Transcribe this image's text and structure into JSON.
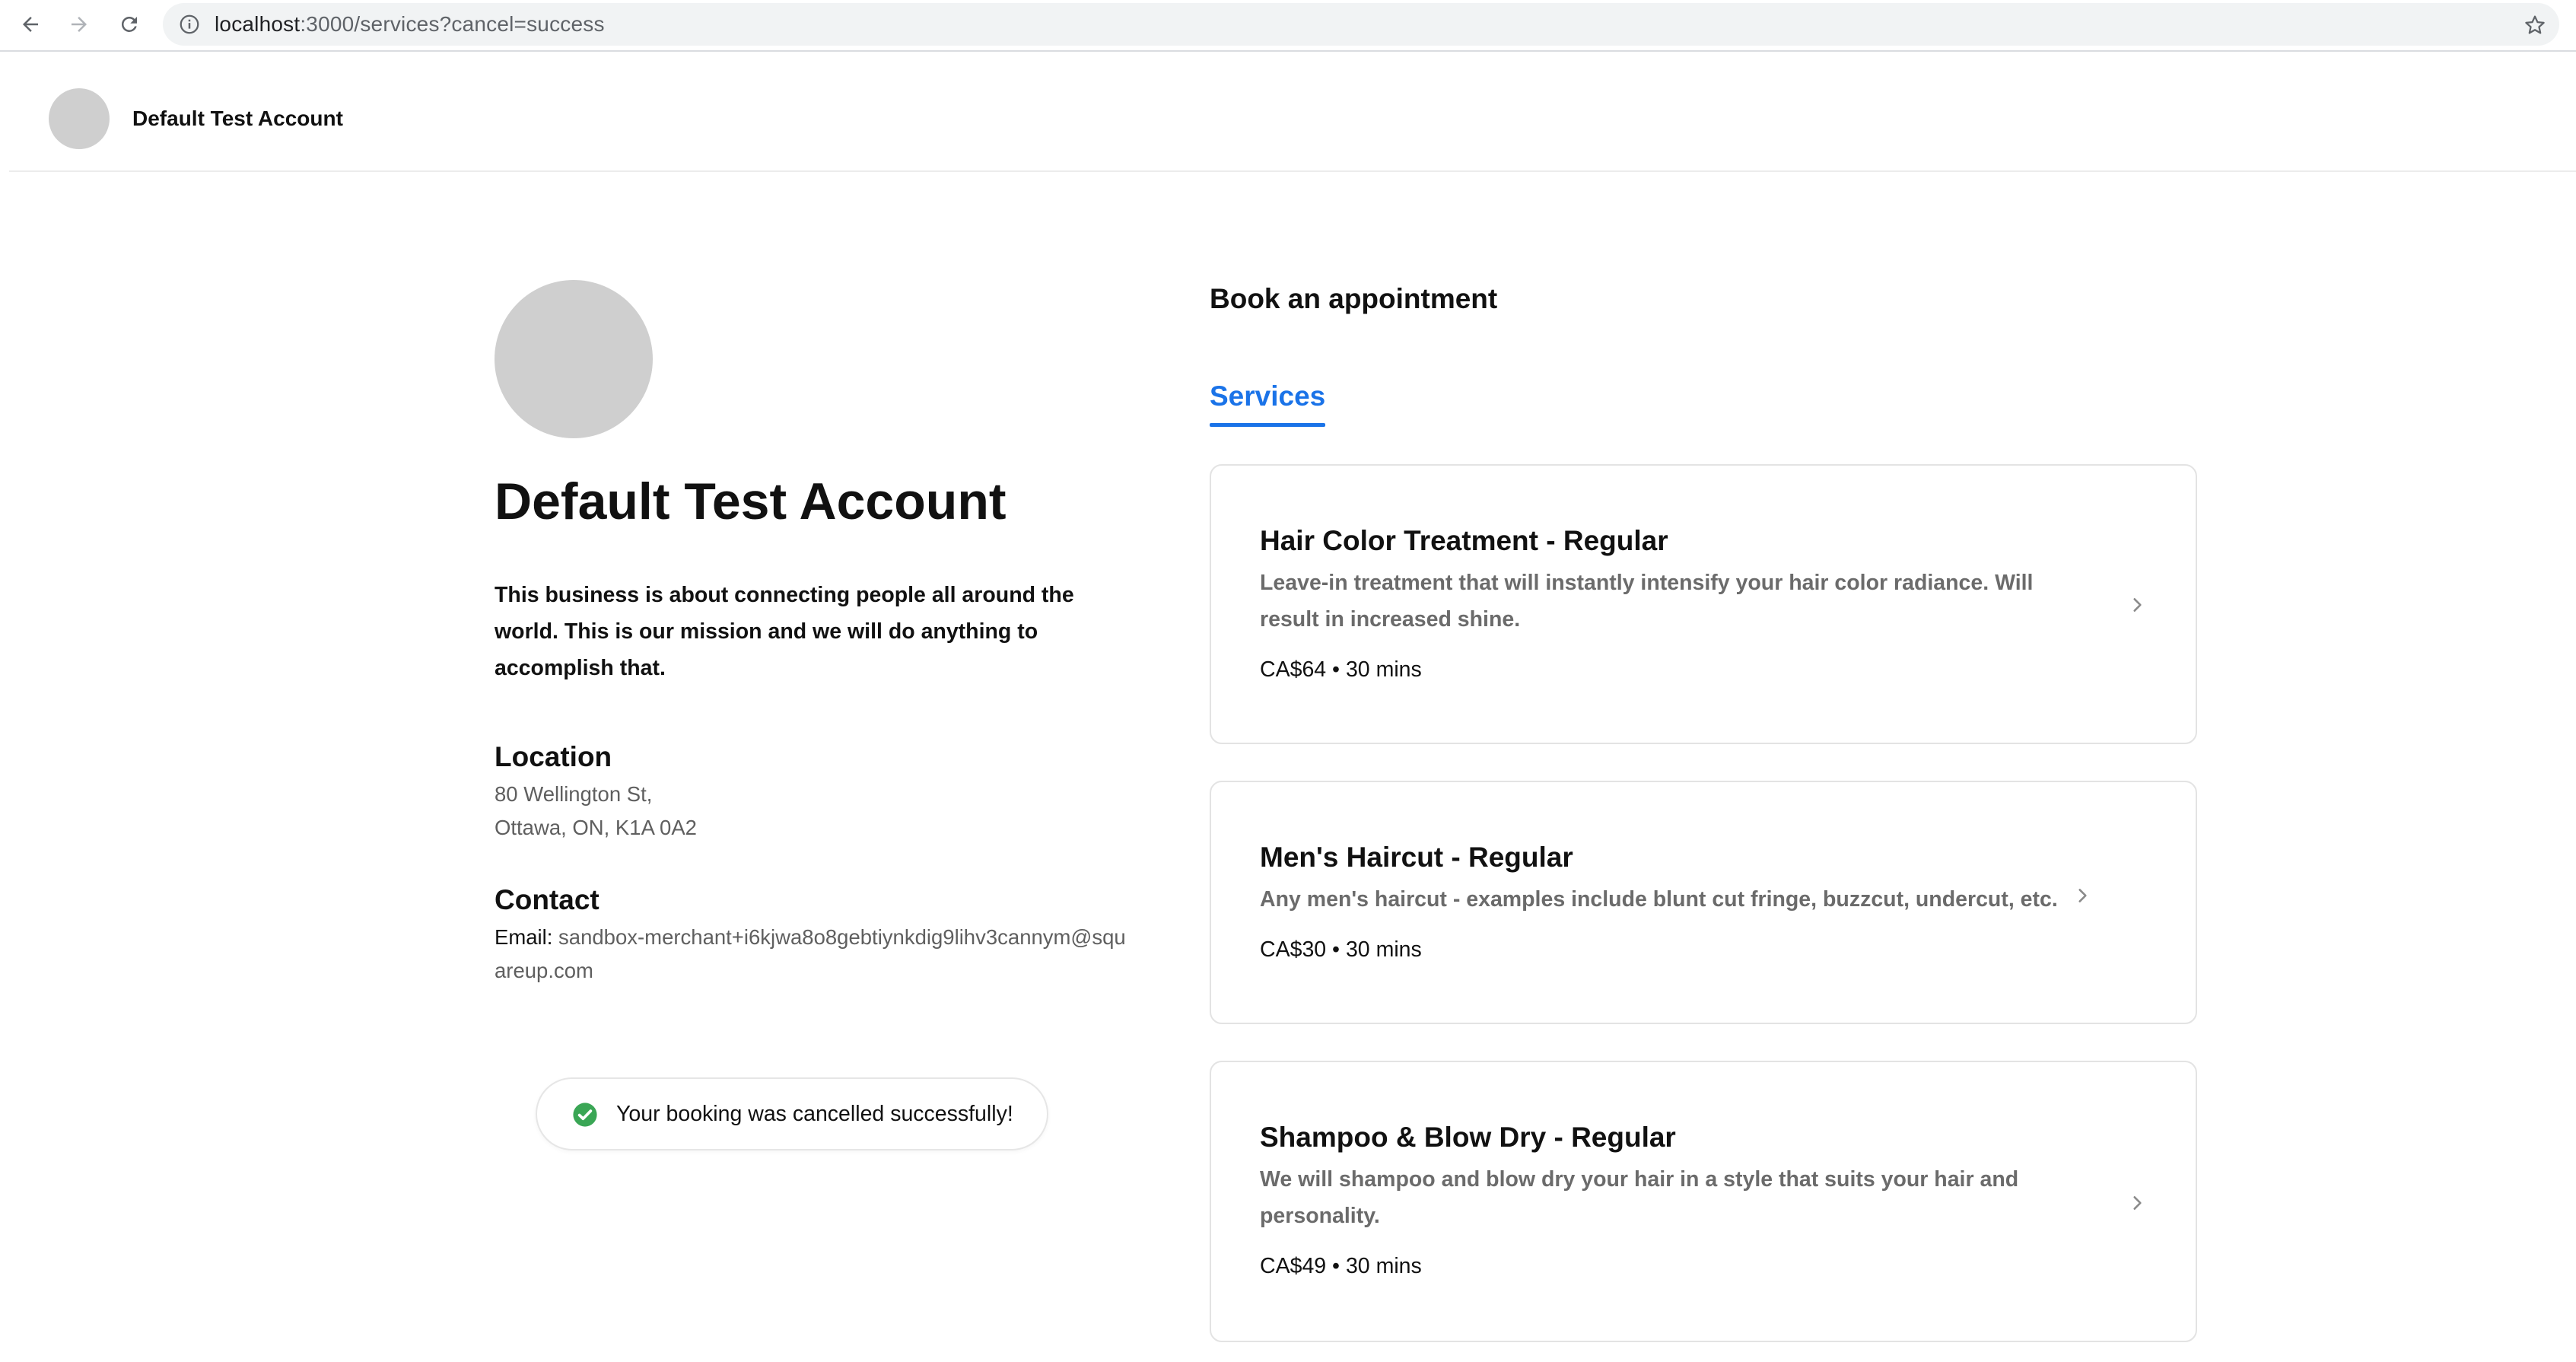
{
  "browser": {
    "url_host": "localhost",
    "url_path": ":3000/services?cancel=success",
    "icons": {
      "back": "arrow-left-icon",
      "forward": "arrow-right-icon",
      "reload": "reload-icon",
      "info": "info-icon",
      "bookmark": "star-icon"
    }
  },
  "header": {
    "account_name": "Default Test Account"
  },
  "profile": {
    "business_name": "Default Test Account",
    "description": "This business is about connecting people all around the world. This is our mission and we will do anything to accomplish that.",
    "location": {
      "heading": "Location",
      "line1": "80 Wellington St,",
      "line2": "Ottawa, ON, K1A 0A2"
    },
    "contact": {
      "heading": "Contact",
      "email_label": "Email:",
      "email_value": "sandbox-merchant+i6kjwa8o8gebtiynkdig9lihv3cannym@squareup.com"
    }
  },
  "toast": {
    "message": "Your booking was cancelled successfully!",
    "icon": "check-circle-icon",
    "color": "#3aa655"
  },
  "booking": {
    "heading": "Book an appointment",
    "tabs": [
      {
        "label": "Services",
        "active": true
      }
    ],
    "accent_color": "#1a73e8",
    "services": [
      {
        "name": "Hair Color Treatment - Regular",
        "description": "Leave-in treatment that will instantly intensify your hair color radiance. Will result in increased shine.",
        "meta": "CA$64 • 30 mins"
      },
      {
        "name": "Men's Haircut - Regular",
        "description": "Any men's haircut - examples include blunt cut fringe, buzzcut, undercut, etc.",
        "meta": "CA$30 • 30 mins"
      },
      {
        "name": "Shampoo & Blow Dry - Regular",
        "description": "We will shampoo and blow dry your hair in a style that suits your hair and personality.",
        "meta": "CA$49 • 30 mins"
      }
    ]
  }
}
